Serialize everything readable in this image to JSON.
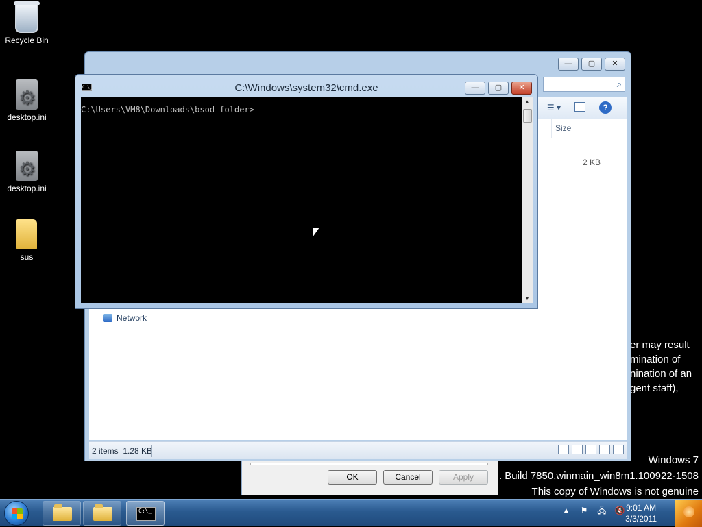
{
  "desktop": {
    "icons": [
      {
        "label": "Recycle Bin"
      },
      {
        "label": "desktop.ini"
      },
      {
        "label": "desktop.ini"
      },
      {
        "label": "sus"
      }
    ]
  },
  "explorer": {
    "column_size": "Size",
    "file_size": "2 KB",
    "nav_network": "Network",
    "status_items": "2 items",
    "status_total": "1.28 KB"
  },
  "cmd": {
    "title": "C:\\Windows\\system32\\cmd.exe",
    "icon_text": "C:\\_",
    "prompt": "C:\\Users\\VM8\\Downloads\\bsod folder>"
  },
  "dialog": {
    "ok": "OK",
    "cancel": "Cancel",
    "apply": "Apply"
  },
  "watermark": {
    "partial_lines": [
      "er may result",
      "mination of",
      "nination of an",
      "gent staff),"
    ],
    "edition": "Windows 7",
    "build": ". Build 7850.winmain_win8m1.100922-1508",
    "genuine": "This copy of Windows is not genuine"
  },
  "taskbar": {
    "cmd_thumb": "C:\\_",
    "time": "9:01 AM",
    "date": "3/3/2011"
  },
  "caption_buttons": {
    "minimize": "—",
    "maximize": "▢",
    "close": "✕"
  },
  "icons": {
    "search": "⌕",
    "help": "?",
    "view_dropdown": "☰ ▾",
    "tray_arrow": "▲",
    "tray_flag": "⚑",
    "tray_network": "🖧",
    "tray_volume": "🔇",
    "scroll_up": "▲",
    "scroll_down": "▼"
  }
}
